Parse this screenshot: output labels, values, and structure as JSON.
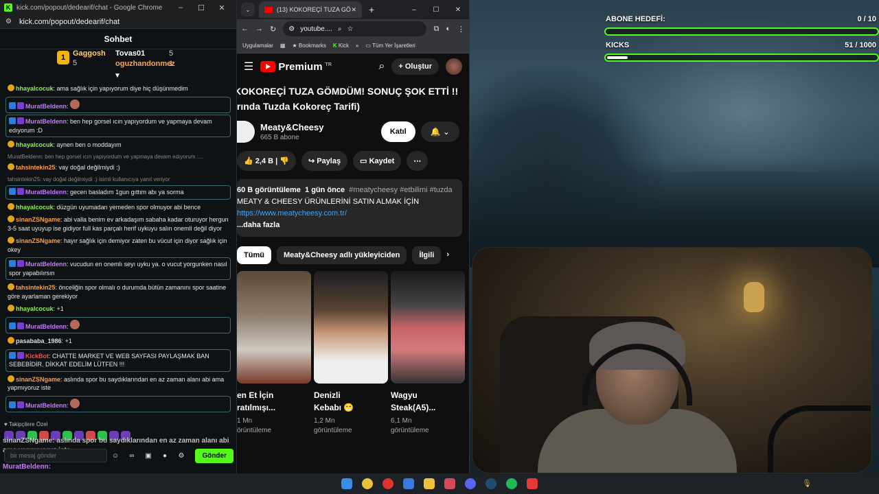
{
  "chat_window": {
    "title": "kick.com/popout/dedearif/chat - Google Chrome",
    "url": "kick.com/popout/dedearif/chat",
    "header": "Sohbet",
    "leaderboard": [
      {
        "rank": "1",
        "name": "Gaggosh",
        "count": "5"
      },
      {
        "name": "Tovas01",
        "count": "5"
      },
      {
        "name": "oguzhandonmez",
        "count": "1"
      }
    ],
    "messages": [
      {
        "user": "hhayalcocuk",
        "color": "green",
        "text": "ama sağlık için yapıyorum diye hiç düşünmedim",
        "boxed": false
      },
      {
        "user": "MuratBeldenn",
        "color": "purple",
        "text": "",
        "boxed": true
      },
      {
        "user": "MuratBeldenn",
        "color": "purple",
        "text": "ben hep gorsel ıcın yapıyordum ve yapmaya devam edıyorum :D",
        "boxed": true
      },
      {
        "user": "hhayalcocuk",
        "color": "green",
        "text": "aynen ben o moddayım",
        "boxed": false
      },
      {
        "reply": "MuratBeldenn: ben hep gorsel ıcın yapıyordum ve yapmaya devam edıyorum :...",
        "user": "tahsintekin25",
        "color": "orange",
        "text": "vay doğal değilmiydi :)",
        "boxed": false
      },
      {
        "reply": "tahsintekin25: vay doğal değilmiydi :) isimli kullanıcıya yanıt veriyor",
        "user": "MuratBeldenn",
        "color": "purple",
        "text": "gecen basladım 1gun gıttım abı ya sorma",
        "boxed": true
      },
      {
        "user": "hhayalcocuk",
        "color": "green",
        "text": "düzgün uyumadan yemeden spor olmuyor abi bence",
        "boxed": false
      },
      {
        "user": "sinanZSNgame",
        "color": "orange",
        "text": "abi valla benim ev arkadaşım sabaha kadar oturuyor hergun 3-5 saat uyuyup ise gidiyor full kas parçalı herif uykuyu salın onemli değil diyor",
        "boxed": false
      },
      {
        "user": "sinanZSNgame",
        "color": "orange",
        "text": "hayır sağlık için demiyor zaten bu vücut için diyor sağlık için okey",
        "boxed": false
      },
      {
        "user": "MuratBeldenn",
        "color": "purple",
        "text": "vucudun en onemlı seyı uyku ya. o vucut yorgunken nasıl spor yapabılırsın",
        "boxed": true
      },
      {
        "user": "tahsintekin25",
        "color": "orange",
        "text": "önceliğin spor olmalı o durumda bütün zamanını spor saatine göre ayarlaman gerekiyor",
        "boxed": false
      },
      {
        "user": "hhayalcocuk",
        "color": "green",
        "text": "+1",
        "boxed": false
      },
      {
        "user": "MuratBeldenn",
        "color": "purple",
        "text": "",
        "boxed": true
      },
      {
        "user": "pasababa_1986",
        "color": "white",
        "text": "+1",
        "boxed": false
      },
      {
        "user": "KickBot",
        "color": "red",
        "text": "CHATTE MARKET VE WEB SAYFASI PAYLAŞMAK BAN SEBEBİDİR. DİKKAT EDELİM LÜTFEN !!!",
        "boxed": true
      },
      {
        "user": "sinanZSNgame",
        "color": "orange",
        "text": "aslında spor bu saydıklarından en az zaman alanı abi ama yapmıyoruz iste",
        "boxed": false
      },
      {
        "user": "MuratBeldenn",
        "color": "purple",
        "text": "",
        "boxed": true
      }
    ],
    "followers_only": "Takipçilere Özel",
    "ghost_text": "sinanZSNgame: aslında spor bu saydıklarından en az zaman alanı abi ama yapmıyoruz iste",
    "ghost_user": "MuratBeldenn:",
    "input_placeholder": "bir mesaj gönder",
    "send_label": "Gönder"
  },
  "youtube_window": {
    "tab_title": "(13) KOKOREÇİ TUZA GÖMDÜM",
    "omnibox": "youtube....",
    "bookmarks": [
      "Uygulamalar",
      "Bookmarks",
      "Kick",
      "Tüm Yer İşaretleri"
    ],
    "logo_text": "Premium",
    "logo_region": "TR",
    "create_label": "Oluştur",
    "video_title_1": "KOKOREÇİ TUZA GÖMDÜM! SONUÇ ŞOK ETTİ !!",
    "video_title_2": "ırında Tuzda Kokoreç Tarifi)",
    "channel_name": "Meaty&Cheesy",
    "subscribers": "665 B abone",
    "join_label": "Katıl",
    "likes": "2,4 B",
    "share_label": "Paylaş",
    "save_label": "Kaydet",
    "desc_views": "60 B görüntüleme",
    "desc_time": "1 gün önce",
    "desc_tags": "#meatycheesy #etbilimi #tuzda",
    "desc_line": "MEATY & CHEESY ÜRÜNLERİNİ SATIN ALMAK İÇİN",
    "desc_link": "https://www.meatycheesy.com.tr/",
    "desc_more": "...daha fazla",
    "chips": [
      "Tümü",
      "Meaty&Cheesy adlı yükleyiciden",
      "İlgili"
    ],
    "shorts": [
      {
        "title_1": "en Et İçin",
        "title_2": "ratılmışı...",
        "views_1": "1 Mn",
        "views_2": "örüntüleme"
      },
      {
        "title_1": "Denizli",
        "title_2": "Kebabı 😁",
        "views_1": "1,2 Mn",
        "views_2": "görüntüleme"
      },
      {
        "title_1": "Wagyu",
        "title_2": "Steak(A5)...",
        "views_1": "6,1 Mn",
        "views_2": "görüntüleme"
      }
    ]
  },
  "overlay": {
    "sub_goal_label": "ABONE HEDEFİ:",
    "sub_goal_value": "0 / 10",
    "sub_goal_fraction": 0.0,
    "kicks_label": "KICKS",
    "kicks_value": "51 / 1000",
    "kicks_fraction": 0.051
  },
  "colors": {
    "kick_green": "#53fc18",
    "youtube_red": "#ff0000"
  }
}
